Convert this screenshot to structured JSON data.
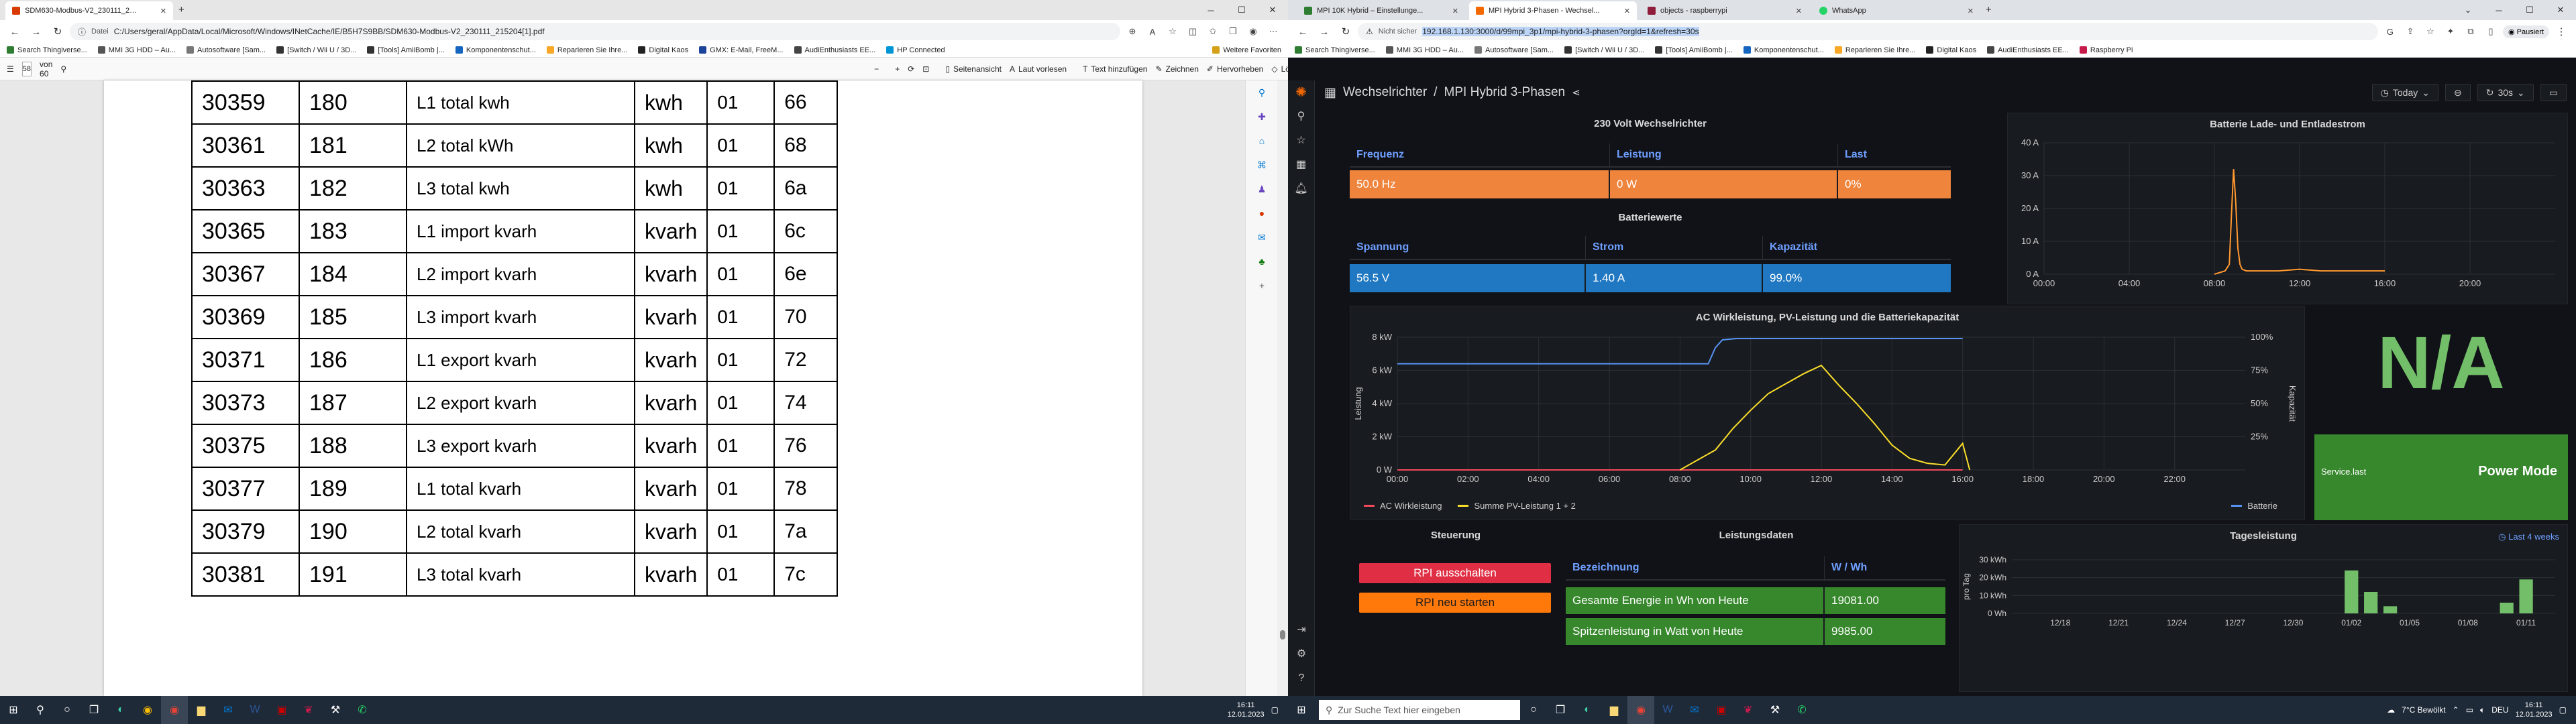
{
  "left_browser": {
    "tab_title": "SDM630-Modbus-V2_230111_2…",
    "address_label": "Datei",
    "url": "C:/Users/geral/AppData/Local/Microsoft/Windows/INetCache/IE/B5H7S9BB/SDM630-Modbus-V2_230111_215204[1].pdf",
    "bookmarks": [
      "Search Thingiverse...",
      "MMI 3G HDD – Au...",
      "Autosoftware [Sam...",
      "[Switch / Wii U / 3D...",
      "[Tools] AmiiBomb |...",
      "Komponentenschut...",
      "Reparieren Sie Ihre...",
      "Digital Kaos",
      "GMX: E-Mail, FreeM...",
      "AudiEnthusiasts EE...",
      "HP Connected"
    ],
    "bookmarks_more": "Weitere Favoriten",
    "pdf_toolbar": {
      "page_current": "58",
      "page_total": "von 60",
      "page_view": "Seitenansicht",
      "read_aloud": "Laut vorlesen",
      "add_text": "Text hinzufügen",
      "draw": "Zeichnen",
      "highlight": "Hervorheben",
      "erase": "Löschen"
    },
    "table_rows": [
      [
        "30359",
        "180",
        "L1 total kwh",
        "kwh",
        "01",
        "66"
      ],
      [
        "30361",
        "181",
        "L2 total kWh",
        "kwh",
        "01",
        "68"
      ],
      [
        "30363",
        "182",
        "L3 total kwh",
        "kwh",
        "01",
        "6a"
      ],
      [
        "30365",
        "183",
        "L1 import kvarh",
        "kvarh",
        "01",
        "6c"
      ],
      [
        "30367",
        "184",
        "L2 import kvarh",
        "kvarh",
        "01",
        "6e"
      ],
      [
        "30369",
        "185",
        "L3 import kvarh",
        "kvarh",
        "01",
        "70"
      ],
      [
        "30371",
        "186",
        "L1 export kvarh",
        "kvarh",
        "01",
        "72"
      ],
      [
        "30373",
        "187",
        "L2 export kvarh",
        "kvarh",
        "01",
        "74"
      ],
      [
        "30375",
        "188",
        "L3 export kvarh",
        "kvarh",
        "01",
        "76"
      ],
      [
        "30377",
        "189",
        "L1 total kvarh",
        "kvarh",
        "01",
        "78"
      ],
      [
        "30379",
        "190",
        "L2 total kvarh",
        "kvarh",
        "01",
        "7a"
      ],
      [
        "30381",
        "191",
        "L3 total kvarh",
        "kvarh",
        "01",
        "7c"
      ]
    ]
  },
  "right_browser": {
    "tabs": [
      "MPI 10K Hybrid – Einstellunge...",
      "MPI Hybrid 3-Phasen - Wechsel...",
      "objects - raspberrypi",
      "WhatsApp"
    ],
    "security": "Nicht sicher",
    "url": "192.168.1.130:3000/d/99mpi_3p1/mpi-hybrid-3-phasen?orgId=1&refresh=30s",
    "profile": "Pausiert",
    "bookmarks": [
      "Search Thingiverse...",
      "MMI 3G HDD – Au...",
      "Autosoftware [Sam...",
      "[Switch / Wii U / 3D...",
      "[Tools] AmiiBomb |...",
      "Komponentenschut...",
      "Reparieren Sie Ihre...",
      "Digital Kaos",
      "AudiEnthusiasts EE...",
      "Raspberry Pi"
    ]
  },
  "grafana": {
    "breadcrumb_folder": "Wechselrichter",
    "breadcrumb_sep": "/",
    "breadcrumb_dash": "MPI Hybrid 3-Phasen",
    "time_range": "Today",
    "refresh": "30s",
    "inverter_panel": {
      "title": "230 Volt Wechselrichter",
      "headers": [
        "Frequenz",
        "Leistung",
        "Last"
      ],
      "values": [
        "50.0 Hz",
        "0 W",
        "0%"
      ]
    },
    "battery_panel": {
      "title": "Batteriewerte",
      "headers": [
        "Spannung",
        "Strom",
        "Kapazität"
      ],
      "values": [
        "56.5 V",
        "1.40 A",
        "99.0%"
      ]
    },
    "control_panel": {
      "title": "Steuerung",
      "btn_shutdown": "RPI ausschalten",
      "btn_restart": "RPI neu starten"
    },
    "power_panel": {
      "title": "Leistungsdaten",
      "headers": [
        "Bezeichnung",
        "W / Wh"
      ],
      "rows": [
        [
          "Gesamte Energie in Wh von Heute",
          "19081.00"
        ],
        [
          "Spitzenleistung in Watt von Heute",
          "9985.00"
        ]
      ]
    },
    "na_panel": {
      "value": "N/A"
    },
    "service_panel": {
      "label": "Service.last",
      "value": "Power Mode"
    },
    "daily_panel": {
      "title": "Tagesleistung",
      "link": "Last 4 weeks"
    }
  },
  "chart_data": [
    {
      "type": "line",
      "title": "Batterie Lade- und Entladestrom",
      "x_ticks": [
        "00:00",
        "04:00",
        "08:00",
        "12:00",
        "16:00",
        "20:00"
      ],
      "y_ticks": [
        "0 A",
        "10 A",
        "20 A",
        "30 A",
        "40 A"
      ],
      "ylim": [
        0,
        40
      ],
      "series": [
        {
          "color": "#ff9830",
          "x": [
            8.0,
            8.5,
            8.7,
            8.8,
            8.9,
            9.0,
            9.1,
            9.2,
            9.3,
            9.5,
            10.0,
            11.0,
            12.0,
            13.0,
            14.0,
            15.0,
            16.0
          ],
          "y": [
            0,
            1,
            3,
            18,
            32,
            22,
            8,
            3,
            1.5,
            1,
            1,
            1,
            1.5,
            1,
            1,
            1,
            1
          ]
        }
      ]
    },
    {
      "type": "line",
      "title": "AC Wirkleistung, PV-Leistung und die Batteriekapazität",
      "ylabel": "Leistung",
      "ylabel_right": "Kapazität",
      "x_ticks": [
        "00:00",
        "02:00",
        "04:00",
        "06:00",
        "08:00",
        "10:00",
        "12:00",
        "14:00",
        "16:00",
        "18:00",
        "20:00",
        "22:00"
      ],
      "y_ticks": [
        "0 W",
        "2 kW",
        "4 kW",
        "6 kW",
        "8 kW"
      ],
      "y_right_ticks": [
        "25%",
        "50%",
        "75%",
        "100%"
      ],
      "ylim": [
        0,
        8
      ],
      "series": [
        {
          "name": "AC Wirkleistung",
          "color": "#f2495c",
          "x": [
            0,
            16
          ],
          "y": [
            0,
            0
          ]
        },
        {
          "name": "Summe PV-Leistung 1 + 2",
          "color": "#fade2a",
          "x": [
            8,
            8.5,
            9,
            9.5,
            10,
            10.5,
            11,
            11.5,
            12,
            12.5,
            13,
            13.5,
            14,
            14.5,
            15,
            15.5,
            16,
            16.2
          ],
          "y": [
            0,
            0.6,
            1.2,
            2.5,
            3.6,
            4.6,
            5.2,
            5.8,
            6.3,
            5.1,
            4.0,
            2.8,
            1.5,
            0.7,
            0.4,
            0.3,
            1.6,
            0
          ]
        },
        {
          "name": "Batterie",
          "color": "#5794f2",
          "axis": "right",
          "x": [
            0,
            8.6,
            8.8,
            9.0,
            9.2,
            9.6,
            10.0,
            12.0,
            16.0
          ],
          "y": [
            80,
            80,
            80,
            92,
            98,
            99,
            99,
            99,
            99
          ]
        }
      ]
    },
    {
      "type": "bar",
      "title": "Tagesleistung",
      "ylabel": "pro Tag",
      "x_ticks": [
        "12/18",
        "12/21",
        "12/24",
        "12/27",
        "12/30",
        "01/02",
        "01/05",
        "01/08",
        "01/11"
      ],
      "y_ticks": [
        "0 Wh",
        "10 kWh",
        "20 kWh",
        "30 kWh"
      ],
      "ylim": [
        0,
        30
      ],
      "series": [
        {
          "color": "#73bf69",
          "x": [
            "01/02",
            "01/03",
            "01/04",
            "01/10",
            "01/11"
          ],
          "y": [
            24,
            12,
            4,
            6,
            19
          ]
        }
      ]
    }
  ],
  "taskbar": {
    "search_placeholder": "Zur Suche Text hier eingeben",
    "left_time": "16:11",
    "left_date": "12.01.2023",
    "weather": "7°C Bewölkt",
    "lang": "DEU",
    "right_time": "16:11",
    "right_date": "12.01.2023"
  }
}
